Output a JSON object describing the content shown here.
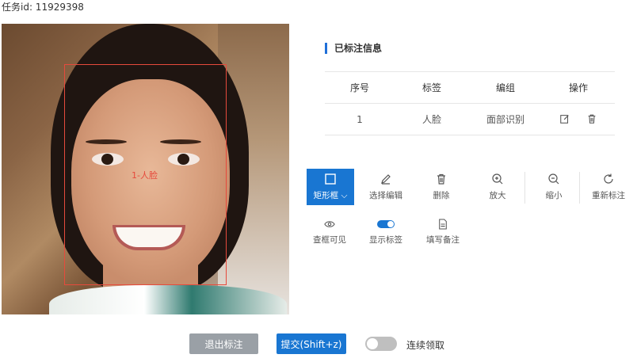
{
  "task": {
    "label": "任务id: 11929398"
  },
  "annotation": {
    "label": "1-人脸",
    "color": "#e64a3c"
  },
  "panel": {
    "title": "已标注信息",
    "columns": [
      "序号",
      "标签",
      "编组",
      "操作"
    ],
    "rows": [
      {
        "index": "1",
        "tag": "人脸",
        "group": "面部识别",
        "actions": [
          "edit-icon",
          "delete-icon"
        ]
      }
    ]
  },
  "toolbar": {
    "tools": [
      {
        "label": "矩形框",
        "icon": "rectangle-icon",
        "active": true
      },
      {
        "label": "选择编辑",
        "icon": "pencil-icon"
      },
      {
        "label": "删除",
        "icon": "trash-icon"
      },
      {
        "label": "放大",
        "icon": "zoom-in-icon"
      },
      {
        "label": "缩小",
        "icon": "zoom-out-icon"
      },
      {
        "label": "重新标注",
        "icon": "refresh-icon"
      }
    ],
    "options": [
      {
        "label": "查框可见",
        "icon": "eye-icon"
      },
      {
        "label": "显示标签",
        "icon": "toggle-icon",
        "on": true
      },
      {
        "label": "填写备注",
        "icon": "note-icon"
      }
    ]
  },
  "footer": {
    "exit_label": "退出标注",
    "submit_label": "提交(Shift+z)",
    "continuous_label": "连续领取",
    "continuous_on": false
  },
  "colors": {
    "accent": "#1976d2",
    "exit_button": "#9aa0a6",
    "bbox": "#e64a3c"
  }
}
